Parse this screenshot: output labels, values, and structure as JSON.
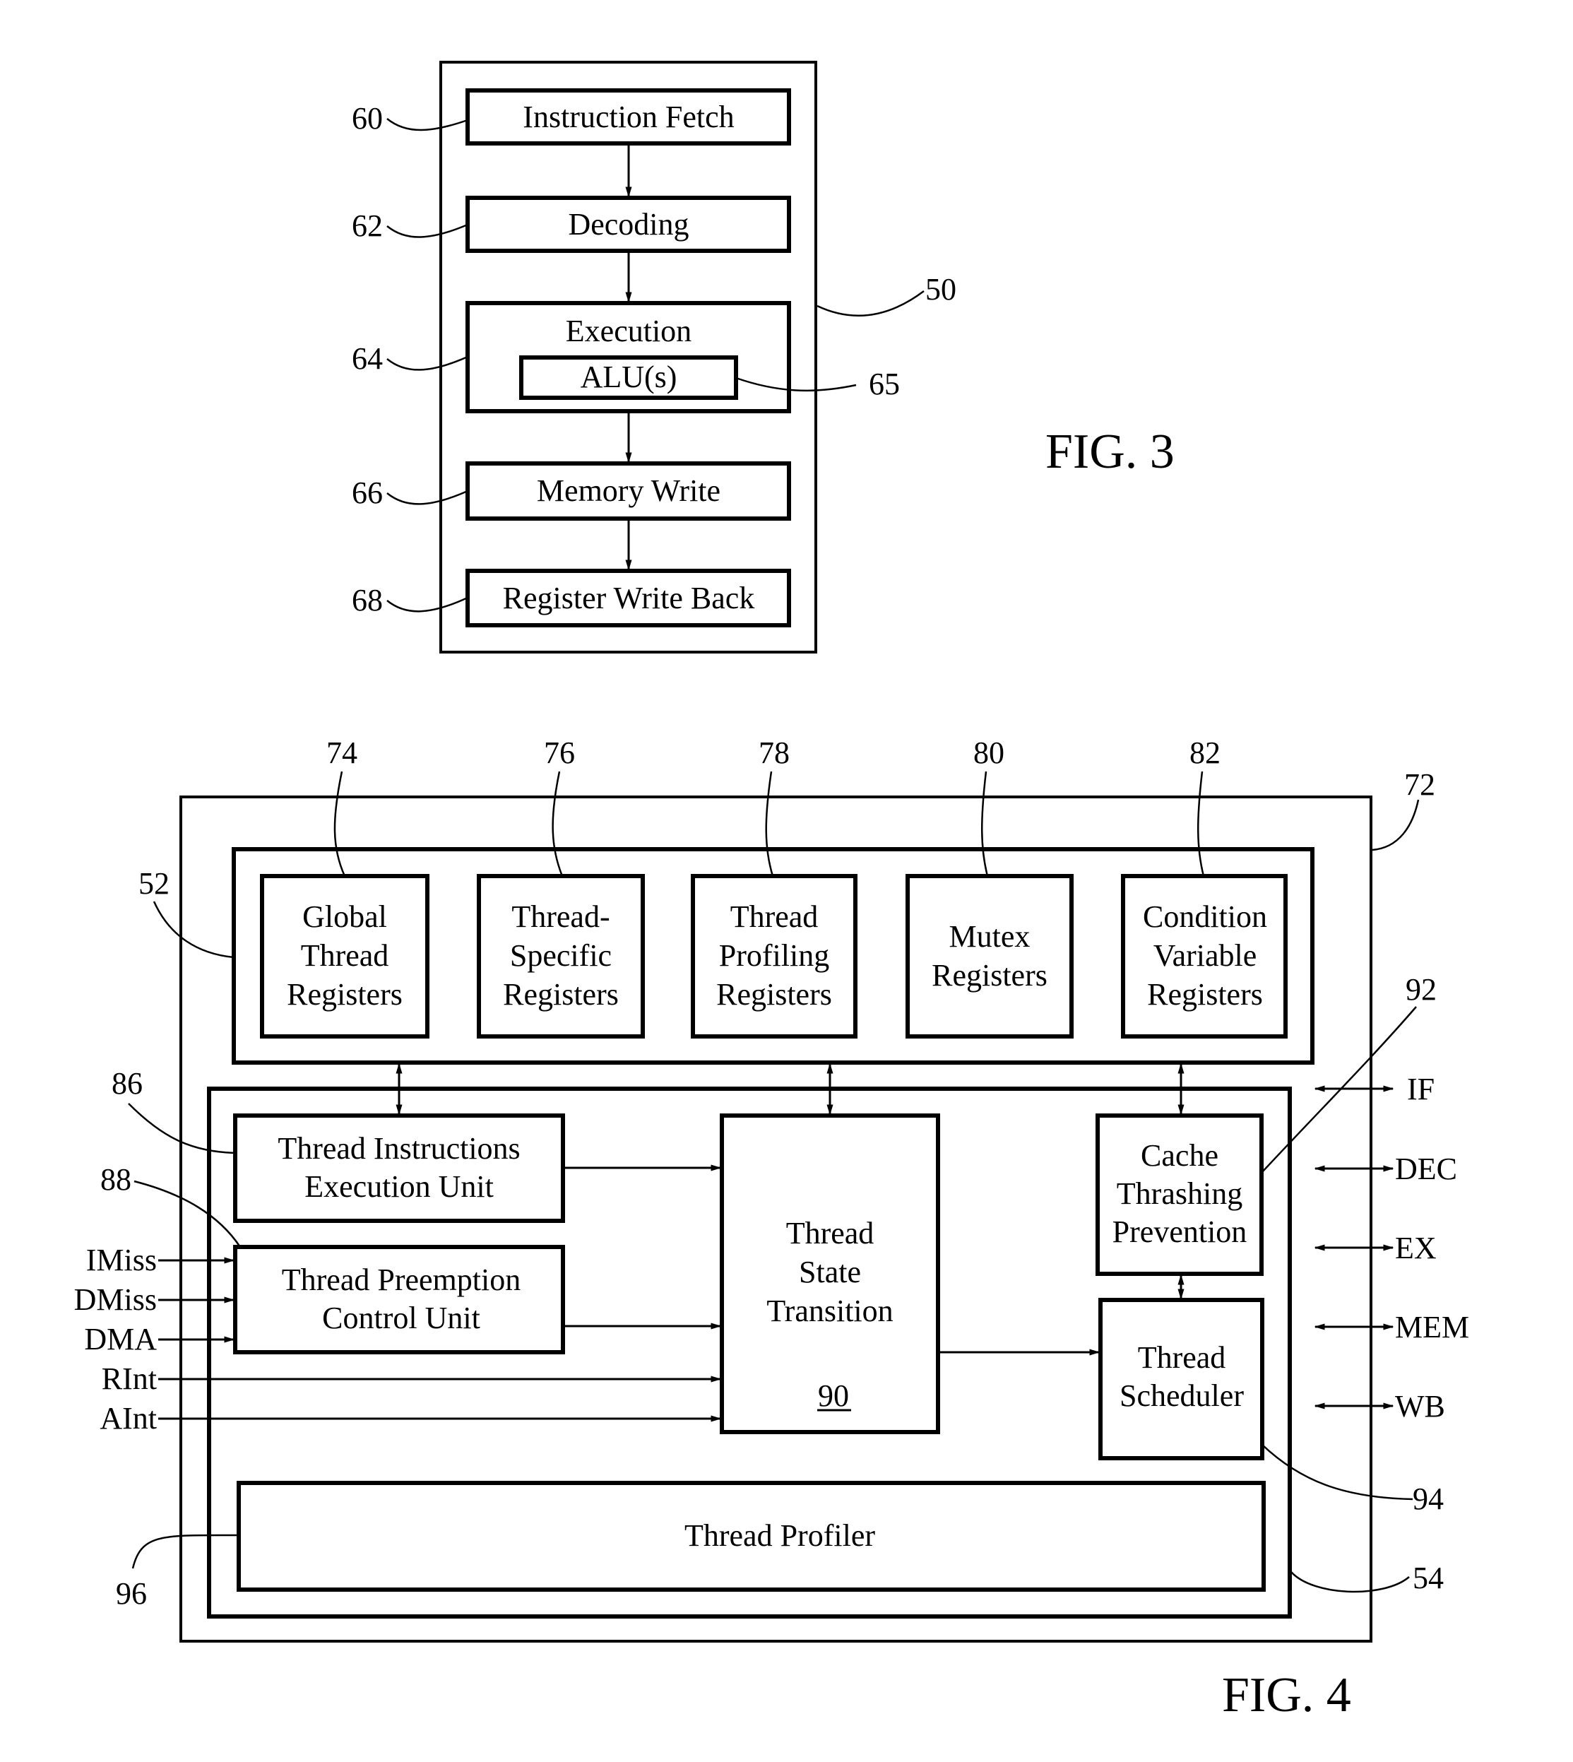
{
  "figure3": {
    "caption": "FIG. 3",
    "container_ref": "50",
    "stages": [
      {
        "ref": "60",
        "label": "Instruction Fetch"
      },
      {
        "ref": "62",
        "label": "Decoding"
      },
      {
        "ref": "64",
        "label": "Execution"
      },
      {
        "ref": "66",
        "label": "Memory Write"
      },
      {
        "ref": "68",
        "label": "Register Write Back"
      }
    ],
    "alu": {
      "ref": "65",
      "label": "ALU(s)"
    }
  },
  "figure4": {
    "caption": "FIG. 4",
    "outer_ref": "72",
    "register_block_ref": "52",
    "control_block_ref": "54",
    "registers": [
      {
        "ref": "74",
        "lines": [
          "Global",
          "Thread",
          "Registers"
        ]
      },
      {
        "ref": "76",
        "lines": [
          "Thread-",
          "Specific",
          "Registers"
        ]
      },
      {
        "ref": "78",
        "lines": [
          "Thread",
          "Profiling",
          "Registers"
        ]
      },
      {
        "ref": "80",
        "lines": [
          "Mutex",
          "Registers"
        ]
      },
      {
        "ref": "82",
        "lines": [
          "Condition",
          "Variable",
          "Registers"
        ]
      }
    ],
    "units": {
      "thread_instructions": {
        "ref": "86",
        "lines": [
          "Thread Instructions",
          "Execution Unit"
        ]
      },
      "thread_preemption": {
        "ref": "88",
        "lines": [
          "Thread Preemption",
          "Control Unit"
        ]
      },
      "thread_state": {
        "ref": "90",
        "lines": [
          "Thread",
          "State",
          "Transition"
        ]
      },
      "cache_thrashing": {
        "ref": "92",
        "lines": [
          "Cache",
          "Thrashing",
          "Prevention"
        ]
      },
      "thread_scheduler": {
        "ref": "94",
        "lines": [
          "Thread",
          "Scheduler"
        ]
      },
      "thread_profiler": {
        "ref": "96",
        "label": "Thread Profiler"
      }
    },
    "input_signals": [
      "IMiss",
      "DMiss",
      "DMA",
      "RInt",
      "AInt"
    ],
    "pipeline_signals": [
      "IF",
      "DEC",
      "EX",
      "MEM",
      "WB"
    ]
  }
}
